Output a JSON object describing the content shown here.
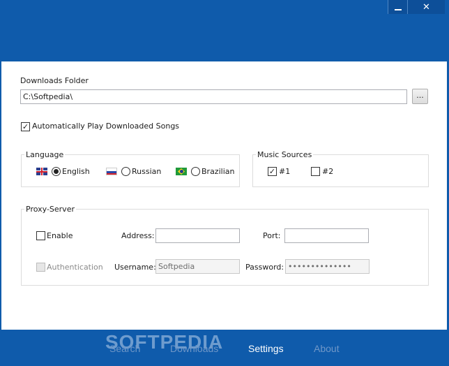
{
  "window": {
    "minimize_icon": "minimize-icon",
    "close_icon": "close-icon",
    "accent_color": "#0f5bab"
  },
  "settings": {
    "downloads_folder_label": "Downloads Folder",
    "downloads_folder_value": "C:\\Softpedia\\",
    "browse_label": "...",
    "autoplay_label": "Automatically Play Downloaded Songs",
    "autoplay_checked": true,
    "language": {
      "title": "Language",
      "options": [
        {
          "label": "English",
          "flag": "uk-flag-icon",
          "selected": true
        },
        {
          "label": "Russian",
          "flag": "russia-flag-icon",
          "selected": false
        },
        {
          "label": "Brazilian",
          "flag": "brazil-flag-icon",
          "selected": false
        }
      ]
    },
    "music_sources": {
      "title": "Music Sources",
      "options": [
        {
          "label": "#1",
          "checked": true
        },
        {
          "label": "#2",
          "checked": false
        }
      ]
    },
    "proxy": {
      "title": "Proxy-Server",
      "enable_label": "Enable",
      "enable_checked": false,
      "address_label": "Address:",
      "address_value": "",
      "port_label": "Port:",
      "port_value": "",
      "authentication_label": "Authentication",
      "authentication_checked": false,
      "username_label": "Username:",
      "username_value": "Softpedia",
      "password_label": "Password:",
      "password_value": "••••••••••••••"
    }
  },
  "footer": {
    "watermark": "SOFTPEDIA",
    "tabs": [
      {
        "label": "Search",
        "active": false
      },
      {
        "label": "Downloads",
        "active": false
      },
      {
        "label": "Settings",
        "active": true
      },
      {
        "label": "About",
        "active": false
      }
    ]
  }
}
